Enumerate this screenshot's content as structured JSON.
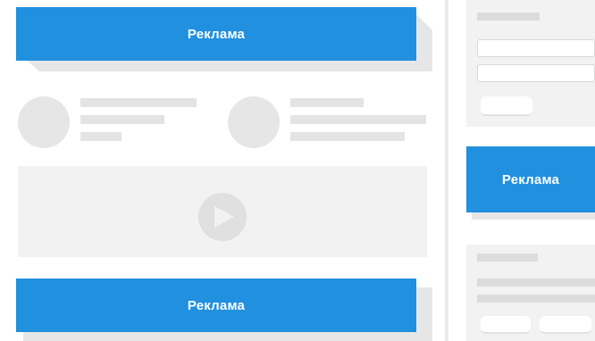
{
  "ads": {
    "top_banner_label": "Реклама",
    "bottom_banner_label": "Реклама",
    "sidebar_banner_label": "Реклама"
  },
  "colors": {
    "ad_blue": "#2090df",
    "placeholder_gray": "#e4e4e4",
    "panel_gray": "#f2f2f2"
  },
  "icons": {
    "video": "play-icon"
  }
}
